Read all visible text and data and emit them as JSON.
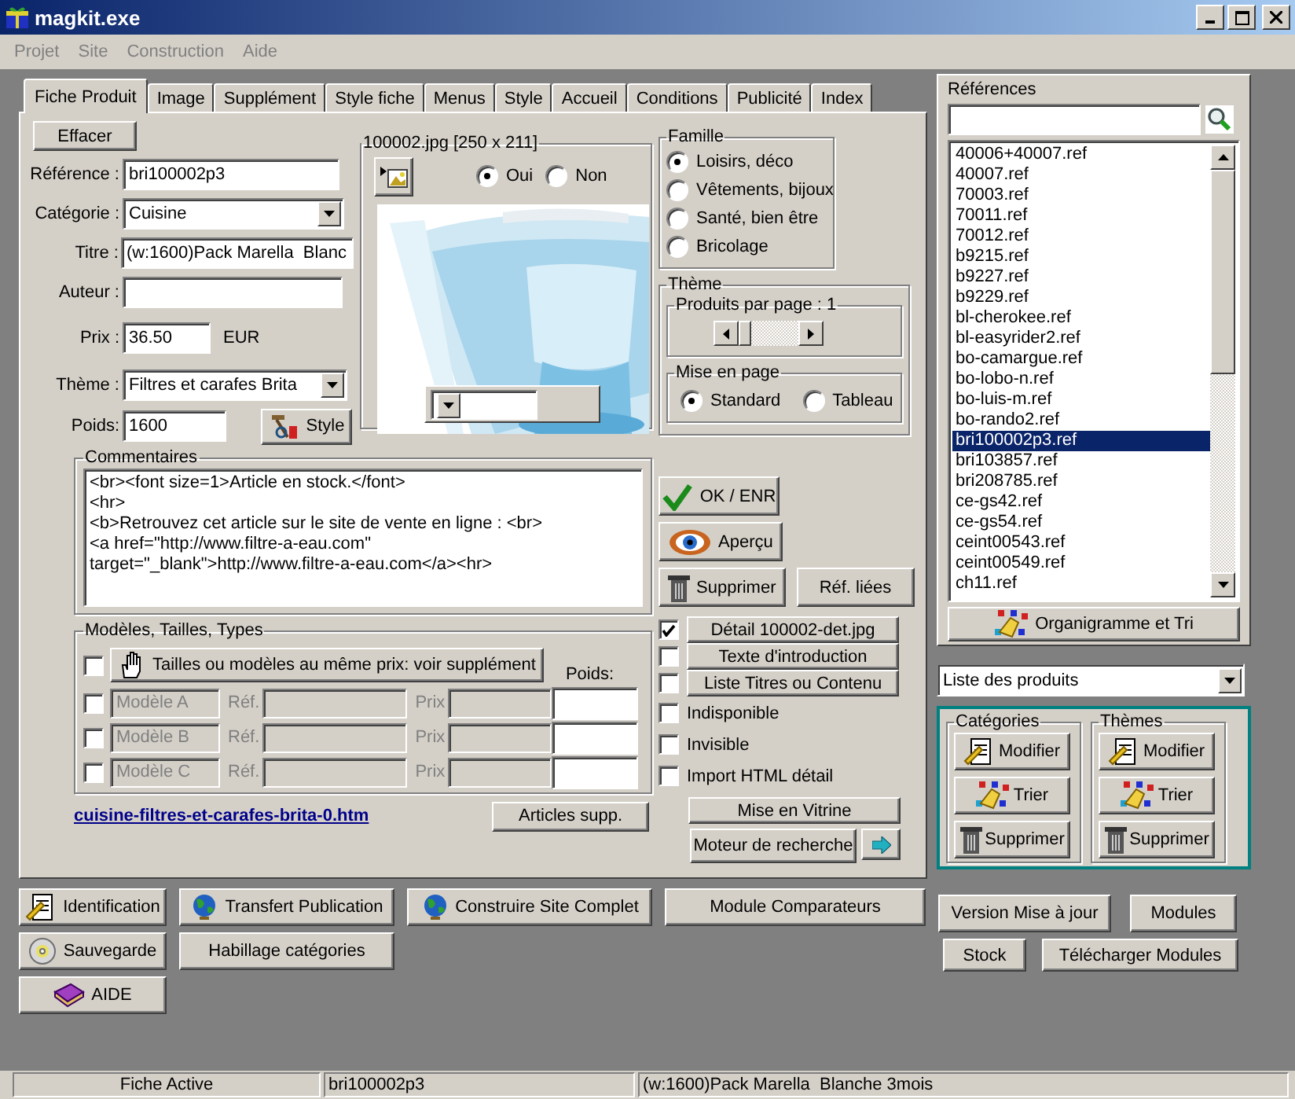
{
  "window": {
    "title": "magkit.exe"
  },
  "menu": [
    "Projet",
    "Site",
    "Construction",
    "Aide"
  ],
  "tabs": [
    {
      "label": "Fiche Produit",
      "selected": true
    },
    {
      "label": "Image",
      "selected": false
    },
    {
      "label": "Supplément",
      "selected": false
    },
    {
      "label": "Style fiche",
      "selected": false
    },
    {
      "label": "Menus",
      "selected": false
    },
    {
      "label": "Style",
      "selected": false
    },
    {
      "label": "Accueil",
      "selected": false
    },
    {
      "label": "Conditions",
      "selected": false
    },
    {
      "label": "Publicité",
      "selected": false
    },
    {
      "label": "Index",
      "selected": false
    }
  ],
  "form": {
    "clear_button": "Effacer",
    "fields": [
      {
        "kind": "text",
        "label": "Référence :",
        "value": "bri100002p3"
      },
      {
        "kind": "select",
        "label": "Catégorie :",
        "value": "Cuisine"
      },
      {
        "kind": "text",
        "label": "Titre :",
        "value": "(w:1600)Pack Marella  Blanc"
      },
      {
        "kind": "text",
        "label": "Auteur :"
      },
      {
        "kind": "price",
        "label": "Prix :",
        "value": "36.50",
        "unit": "EUR"
      },
      {
        "kind": "select",
        "label": "Thème :",
        "value": "Filtres et carafes Brita"
      },
      {
        "kind": "weight",
        "label": "Poids:",
        "value": "1600",
        "button": "Style"
      }
    ]
  },
  "image": {
    "caption": "100002.jpg [250 x 211]",
    "options": [
      {
        "label": "Oui",
        "selected": true
      },
      {
        "label": "Non",
        "selected": false
      }
    ]
  },
  "famille": {
    "title": "Famille",
    "options": [
      {
        "label": "Loisirs, déco",
        "selected": true
      },
      {
        "label": "Vêtements, bijoux",
        "selected": false
      },
      {
        "label": "Santé, bien être",
        "selected": false
      },
      {
        "label": "Bricolage",
        "selected": false
      }
    ]
  },
  "theme": {
    "title": "Thème",
    "per_page": {
      "label": "Produits par page : 1",
      "level": 0
    },
    "layout": {
      "title": "Mise en page",
      "options": [
        {
          "label": "Standard",
          "selected": true
        },
        {
          "label": "Tableau",
          "selected": false
        }
      ]
    }
  },
  "comments": {
    "title": "Commentaires",
    "lines": [
      "<br><font size=1>Article en stock.</font>",
      "<hr>",
      "<b>Retrouvez cet article sur le site de vente en ligne : <br>",
      "<a href=\"http://www.filtre-a-eau.com\"",
      "target=\"_blank\">http://www.filtre-a-eau.com</a><hr>"
    ]
  },
  "models": {
    "title": "Modèles, Tailles, Types",
    "same_price": {
      "label": "Tailles ou modèles au même prix: voir supplément",
      "checked": false
    },
    "weight_label": "Poids:",
    "rows": [
      {
        "name": "Modèle A",
        "ref_label": "Réf.",
        "price_label": "Prix",
        "checked": false
      },
      {
        "name": "Modèle B",
        "ref_label": "Réf.",
        "price_label": "Prix",
        "checked": false
      },
      {
        "name": "Modèle C",
        "ref_label": "Réf.",
        "price_label": "Prix",
        "checked": false
      }
    ]
  },
  "page_link": "cuisine-filtres-et-carafes-brita-0.htm",
  "extra_button": "Articles supp.",
  "actions": {
    "ok": "OK / ENR",
    "preview": "Aperçu",
    "delete": "Supprimer",
    "linked": "Réf. liées"
  },
  "options": [
    {
      "kind": "button",
      "label": "Détail 100002-det.jpg",
      "checked": true
    },
    {
      "kind": "button",
      "label": "Texte d'introduction",
      "checked": false
    },
    {
      "kind": "button",
      "label": "Liste Titres ou Contenu",
      "checked": false
    },
    {
      "kind": "label",
      "label": "Indisponible",
      "checked": false
    },
    {
      "kind": "label",
      "label": "Invisible",
      "checked": false
    },
    {
      "kind": "label",
      "label": "Import HTML détail",
      "checked": false
    }
  ],
  "showcase": "Mise en Vitrine",
  "search_engine": "Moteur de recherche",
  "references": {
    "title": "Références",
    "chart_button": "Organigramme et Tri",
    "items": [
      {
        "label": "40006+40007.ref",
        "selected": false
      },
      {
        "label": "40007.ref",
        "selected": false
      },
      {
        "label": "70003.ref",
        "selected": false
      },
      {
        "label": "70011.ref",
        "selected": false
      },
      {
        "label": "70012.ref",
        "selected": false
      },
      {
        "label": "b9215.ref",
        "selected": false
      },
      {
        "label": "b9227.ref",
        "selected": false
      },
      {
        "label": "b9229.ref",
        "selected": false
      },
      {
        "label": "bl-cherokee.ref",
        "selected": false
      },
      {
        "label": "bl-easyrider2.ref",
        "selected": false
      },
      {
        "label": "bo-camargue.ref",
        "selected": false
      },
      {
        "label": "bo-lobo-n.ref",
        "selected": false
      },
      {
        "label": "bo-luis-m.ref",
        "selected": false
      },
      {
        "label": "bo-rando2.ref",
        "selected": false
      },
      {
        "label": "bri100002p3.ref",
        "selected": true
      },
      {
        "label": "bri103857.ref",
        "selected": false
      },
      {
        "label": "bri208785.ref",
        "selected": false
      },
      {
        "label": "ce-gs42.ref",
        "selected": false
      },
      {
        "label": "ce-gs54.ref",
        "selected": false
      },
      {
        "label": "ceint00543.ref",
        "selected": false
      },
      {
        "label": "ceint00549.ref",
        "selected": false
      },
      {
        "label": "ch11.ref",
        "selected": false
      }
    ]
  },
  "list_select": "Liste des produits",
  "groups": [
    {
      "title": "Catégories",
      "buttons": [
        "Modifier",
        "Trier",
        "Supprimer"
      ]
    },
    {
      "title": "Thèmes",
      "buttons": [
        "Modifier",
        "Trier",
        "Supprimer"
      ]
    }
  ],
  "bottom_left": [
    [
      "Identification",
      "Transfert Publication",
      "Construire Site Complet",
      "Module Comparateurs"
    ],
    [
      "Sauvegarde",
      "Habillage catégories"
    ],
    [
      "AIDE"
    ]
  ],
  "bottom_right": [
    [
      "Version Mise à jour",
      "Modules"
    ],
    [
      "Stock",
      "Télécharger Modules"
    ]
  ],
  "status_bar": [
    "Fiche Active",
    "bri100002p3",
    "(w:1600)Pack Marella  Blanche 3mois"
  ]
}
